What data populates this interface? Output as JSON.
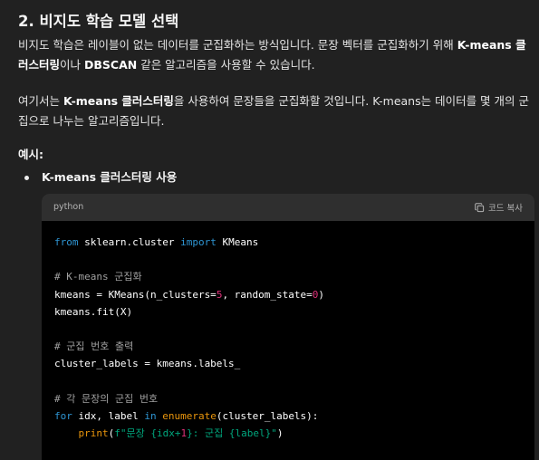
{
  "section": {
    "title": "2. 비지도 학습 모델 선택"
  },
  "paragraph1": {
    "part1": "비지도 학습은 레이블이 없는 데이터를 군집화하는 방식입니다. 문장 벡터를 군집화하기 위해 ",
    "bold1": "K-means 클러스터링",
    "part2": "이나 ",
    "bold2": "DBSCAN",
    "part3": " 같은 알고리즘을 사용할 수 있습니다."
  },
  "paragraph2": {
    "part1": "여기서는 ",
    "bold1": "K-means 클러스터링",
    "part2": "을 사용하여 문장들을 군집화할 것입니다. K-means는 데이터를 몇 개의 군집으로 나누는 알고리즘입니다."
  },
  "example": {
    "label": "예시:"
  },
  "bullet": {
    "text": "K-means 클러스터링 사용"
  },
  "code_block": {
    "language": "python",
    "copy_label": "코드 복사",
    "lines": [
      [
        {
          "t": "from",
          "c": "keyword"
        },
        {
          "t": " sklearn.cluster ",
          "c": "plain"
        },
        {
          "t": "import",
          "c": "keyword"
        },
        {
          "t": " KMeans",
          "c": "plain"
        }
      ],
      [],
      [
        {
          "t": "# K-means 군집화",
          "c": "comment"
        }
      ],
      [
        {
          "t": "kmeans = KMeans(n_clusters=",
          "c": "plain"
        },
        {
          "t": "5",
          "c": "number"
        },
        {
          "t": ", random_state=",
          "c": "plain"
        },
        {
          "t": "0",
          "c": "number"
        },
        {
          "t": ")",
          "c": "plain"
        }
      ],
      [
        {
          "t": "kmeans.fit(X)",
          "c": "plain"
        }
      ],
      [],
      [
        {
          "t": "# 군집 번호 출력",
          "c": "comment"
        }
      ],
      [
        {
          "t": "cluster_labels = kmeans.labels_",
          "c": "plain"
        }
      ],
      [],
      [
        {
          "t": "# 각 문장의 군집 번호",
          "c": "comment"
        }
      ],
      [
        {
          "t": "for",
          "c": "keyword"
        },
        {
          "t": " idx, label ",
          "c": "plain"
        },
        {
          "t": "in",
          "c": "keyword"
        },
        {
          "t": " ",
          "c": "plain"
        },
        {
          "t": "enumerate",
          "c": "builtin"
        },
        {
          "t": "(cluster_labels):",
          "c": "plain"
        }
      ],
      [
        {
          "t": "    ",
          "c": "plain"
        },
        {
          "t": "print",
          "c": "builtin"
        },
        {
          "t": "(",
          "c": "plain"
        },
        {
          "t": "f\"문장 {idx+",
          "c": "string"
        },
        {
          "t": "1",
          "c": "number"
        },
        {
          "t": "}: 군집 {label}\"",
          "c": "string"
        },
        {
          "t": ")",
          "c": "plain"
        }
      ]
    ]
  },
  "colors": {
    "background": "#212121",
    "code_background": "#000000",
    "code_header": "#2f2f2f",
    "keyword": "#2e95d3",
    "number": "#df3079",
    "string": "#00a67d",
    "comment": "#a0a0a0",
    "builtin": "#e9950c"
  },
  "icons": {
    "copy": "copy-icon"
  }
}
